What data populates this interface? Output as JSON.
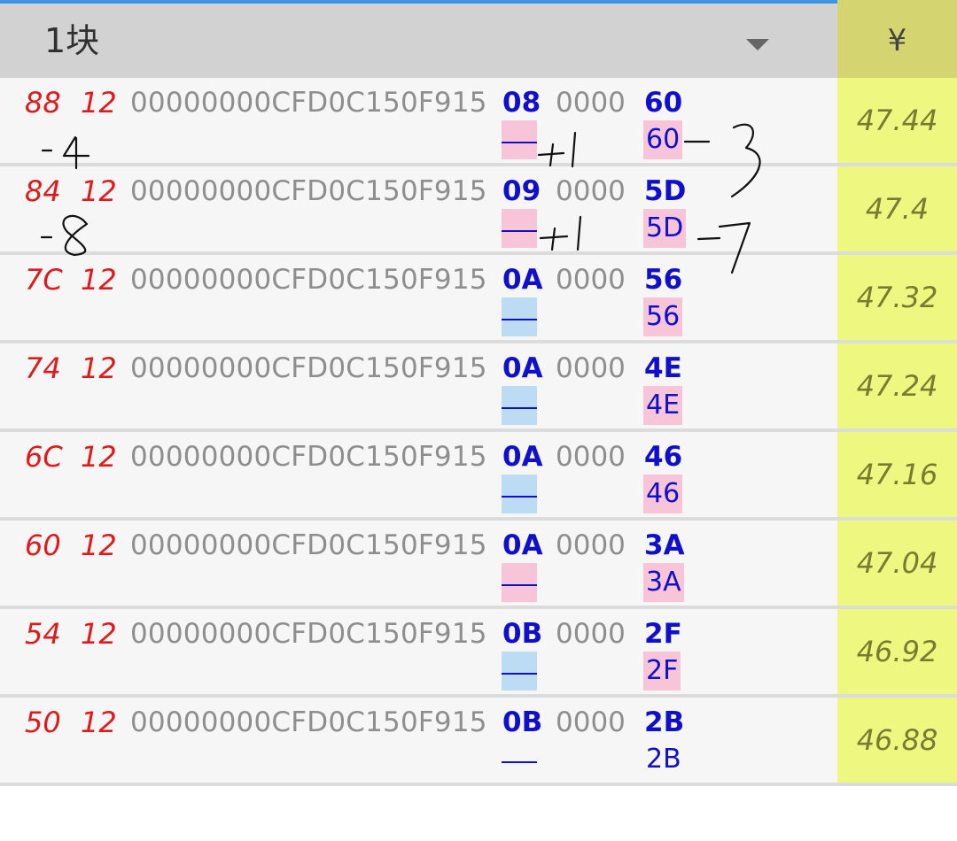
{
  "header": {
    "selector_label": "1块",
    "currency_label": "¥"
  },
  "rows": [
    {
      "c1": "88",
      "c2": "12",
      "hash": "00000000CFD0C150F915",
      "code": "08",
      "zeros": "0000",
      "value": "60",
      "dash": "—",
      "sub": "60",
      "flag_color": "pink",
      "sub_bg": "pink",
      "price": "47.44"
    },
    {
      "c1": "84",
      "c2": "12",
      "hash": "00000000CFD0C150F915",
      "code": "09",
      "zeros": "0000",
      "value": "5D",
      "dash": "—",
      "sub": "5D",
      "flag_color": "pink",
      "sub_bg": "pink",
      "price": "47.4"
    },
    {
      "c1": "7C",
      "c2": "12",
      "hash": "00000000CFD0C150F915",
      "code": "0A",
      "zeros": "0000",
      "value": "56",
      "dash": "—",
      "sub": "56",
      "flag_color": "blue",
      "sub_bg": "pink",
      "price": "47.32"
    },
    {
      "c1": "74",
      "c2": "12",
      "hash": "00000000CFD0C150F915",
      "code": "0A",
      "zeros": "0000",
      "value": "4E",
      "dash": "—",
      "sub": "4E",
      "flag_color": "blue",
      "sub_bg": "pink",
      "price": "47.24"
    },
    {
      "c1": "6C",
      "c2": "12",
      "hash": "00000000CFD0C150F915",
      "code": "0A",
      "zeros": "0000",
      "value": "46",
      "dash": "—",
      "sub": "46",
      "flag_color": "blue",
      "sub_bg": "pink",
      "price": "47.16"
    },
    {
      "c1": "60",
      "c2": "12",
      "hash": "00000000CFD0C150F915",
      "code": "0A",
      "zeros": "0000",
      "value": "3A",
      "dash": "—",
      "sub": "3A",
      "flag_color": "pink",
      "sub_bg": "pink",
      "price": "47.04"
    },
    {
      "c1": "54",
      "c2": "12",
      "hash": "00000000CFD0C150F915",
      "code": "0B",
      "zeros": "0000",
      "value": "2F",
      "dash": "—",
      "sub": "2F",
      "flag_color": "blue",
      "sub_bg": "pink",
      "price": "46.92"
    },
    {
      "c1": "50",
      "c2": "12",
      "hash": "00000000CFD0C150F915",
      "code": "0B",
      "zeros": "0000",
      "value": "2B",
      "dash": "—",
      "sub": "2B",
      "flag_color": "none",
      "sub_bg": "none",
      "price": "46.88"
    }
  ],
  "annotations": {
    "row1_left": "-4",
    "row1_mid": "+1",
    "row1_right": "-3",
    "row2_left": "-8",
    "row2_mid": "+1",
    "row2_right": "-7"
  },
  "colors": {
    "accent_line": "#3d95e6",
    "price_column": "#eef780",
    "header_price_column": "#d4d470",
    "pink_flag": "#f7c4d8",
    "blue_flag": "#bcdcf4"
  }
}
